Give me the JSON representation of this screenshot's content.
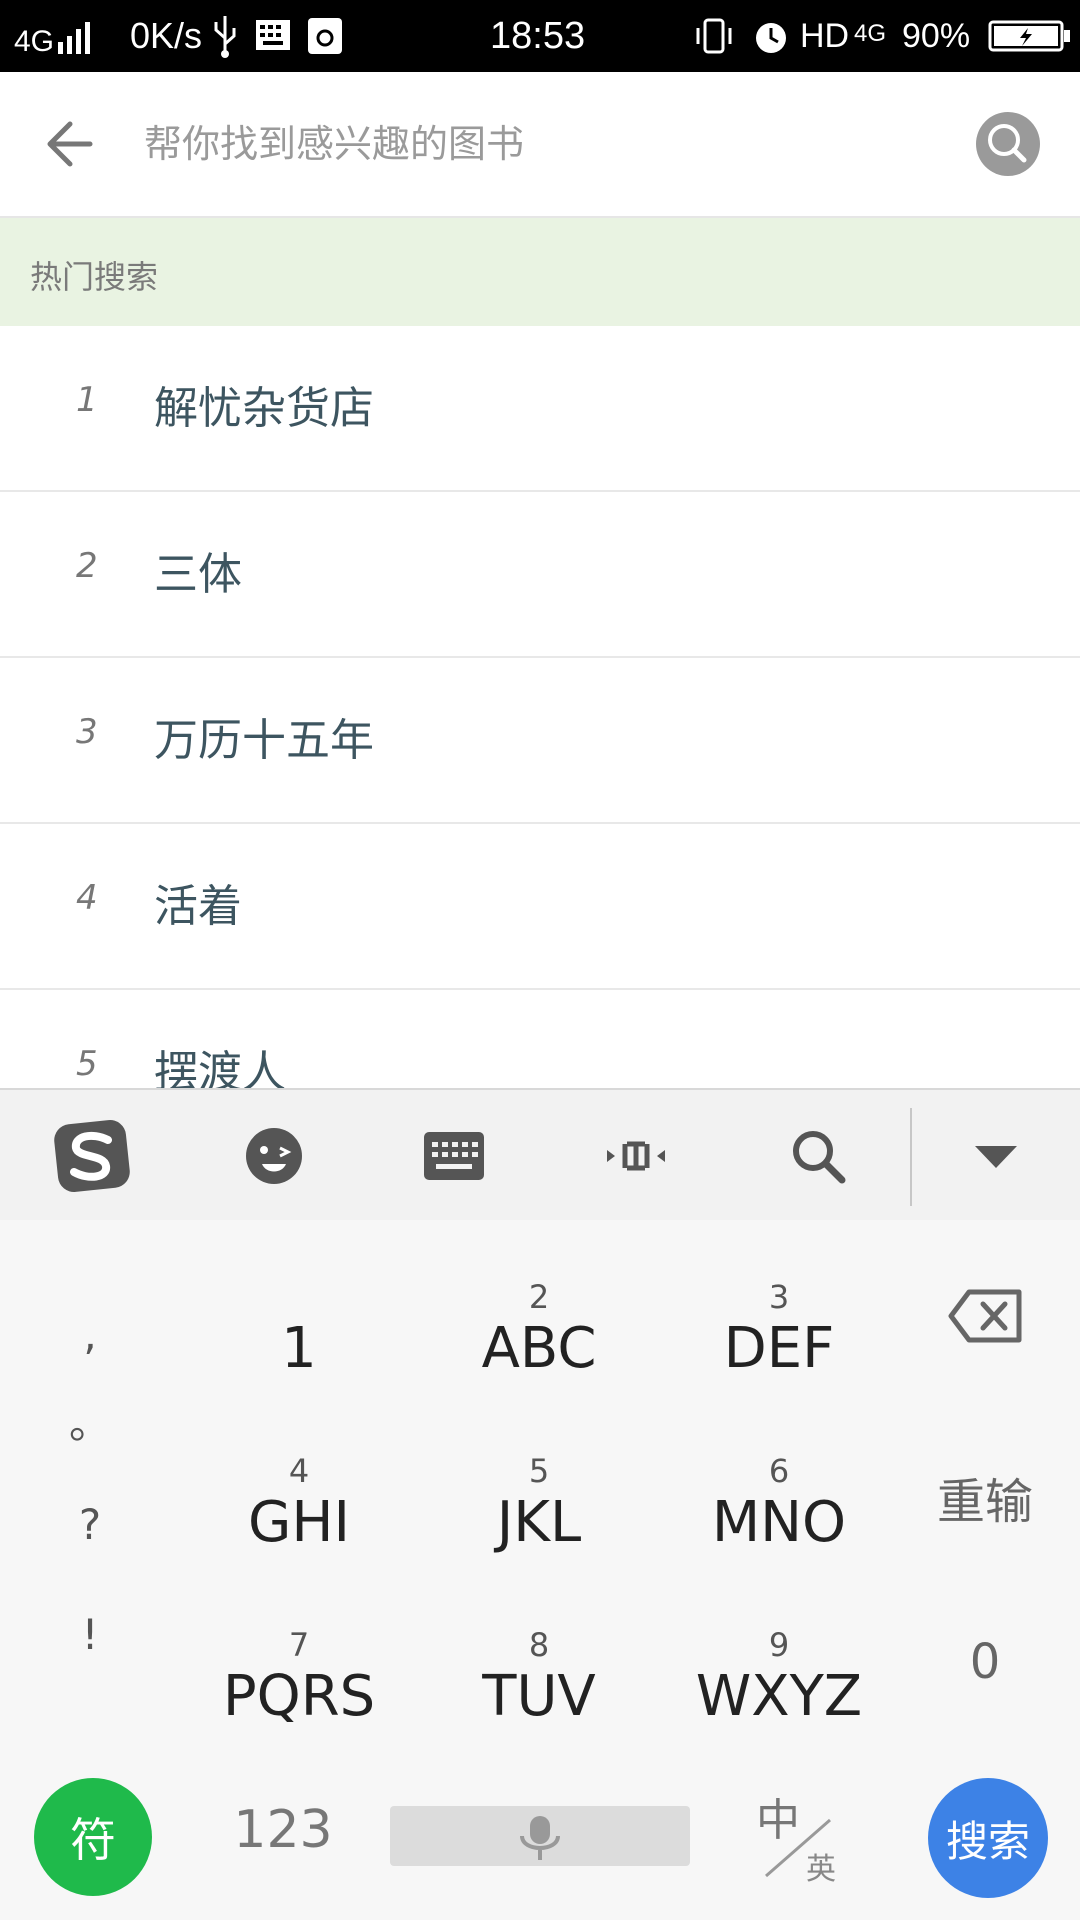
{
  "status_bar": {
    "network": "4G",
    "speed": "0K/s",
    "time": "18:53",
    "hd": "HD",
    "net_right": "4G",
    "battery": "90%"
  },
  "search": {
    "placeholder": "帮你找到感兴趣的图书"
  },
  "hot": {
    "header": "热门搜索",
    "items": [
      {
        "rank": "1",
        "title": "解忧杂货店"
      },
      {
        "rank": "2",
        "title": "三体"
      },
      {
        "rank": "3",
        "title": "万历十五年"
      },
      {
        "rank": "4",
        "title": "活着"
      },
      {
        "rank": "5",
        "title": "摆渡人"
      }
    ]
  },
  "keyboard": {
    "symbols": [
      ",",
      "。",
      "?",
      "!"
    ],
    "keys": [
      {
        "num": "",
        "letters": "1"
      },
      {
        "num": "2",
        "letters": "ABC"
      },
      {
        "num": "3",
        "letters": "DEF"
      },
      {
        "num": "4",
        "letters": "GHI"
      },
      {
        "num": "5",
        "letters": "JKL"
      },
      {
        "num": "6",
        "letters": "MNO"
      },
      {
        "num": "7",
        "letters": "PQRS"
      },
      {
        "num": "8",
        "letters": "TUV"
      },
      {
        "num": "9",
        "letters": "WXYZ"
      }
    ],
    "reset": "重输",
    "zero": "0",
    "symbol_key": "符",
    "num_key": "123",
    "lang_main": "中",
    "lang_sub": "英",
    "search_key": "搜索"
  },
  "colors": {
    "hot_header_bg": "#e9f3e2",
    "title_color": "#3d5560",
    "symbol_btn": "#1fba4b",
    "search_btn": "#3d82e6"
  }
}
